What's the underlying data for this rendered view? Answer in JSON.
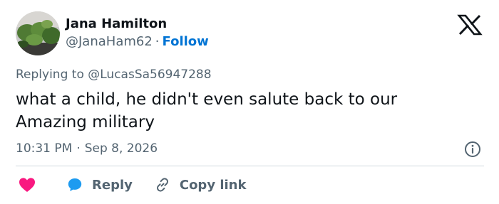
{
  "author": {
    "name": "Jana Hamilton",
    "handle": "@JanaHam62",
    "separator": "·",
    "follow_label": "Follow"
  },
  "tweet": {
    "replying_prefix": "Replying to",
    "replying_to": "@LucasSa56947288",
    "text": "what a child, he didn't even salute back to our Amazing military",
    "time": "10:31 PM",
    "separator": "·",
    "date": "Sep 8, 2026"
  },
  "actions": {
    "reply_label": "Reply",
    "copy_link_label": "Copy link"
  },
  "icons": {
    "logo": "x-logo-icon",
    "info": "info-icon",
    "like": "heart-icon",
    "reply": "reply-bubble-icon",
    "copy": "link-icon"
  },
  "colors": {
    "follow": "#0074d4",
    "secondary_text": "#536471",
    "heart": "#f91880",
    "reply_bubble": "#1d9bf0",
    "divider": "#cfd9de"
  }
}
